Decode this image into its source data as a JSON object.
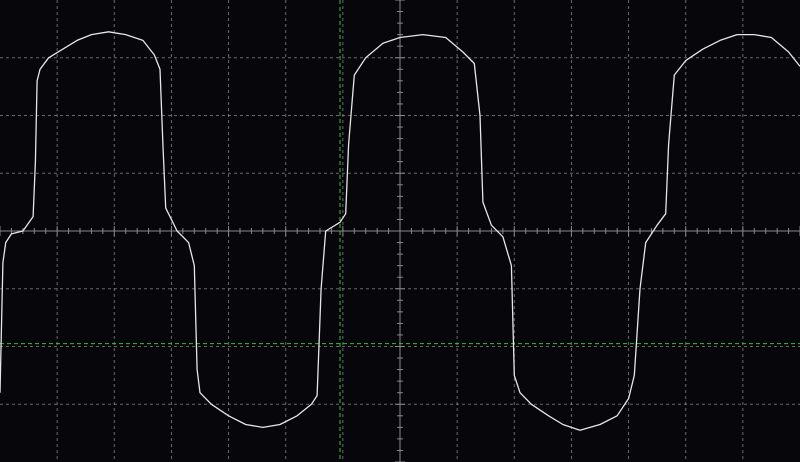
{
  "screen": {
    "background_color": "#07060b",
    "grid_color": "#8a8a8a",
    "trace_color": "#e6e6e6",
    "cursor_color": "#35c23a"
  },
  "graticule": {
    "horizontal_divisions": 14,
    "vertical_divisions": 8,
    "minor_ticks_per_division": 5
  },
  "cursors": {
    "vertical_cursor_division": 5.95,
    "horizontal_cursor_division": -1.95,
    "style": "dashed"
  },
  "chart_data": {
    "type": "line",
    "title": "",
    "xlabel": "",
    "ylabel": "",
    "x_unit": "divisions",
    "y_unit": "divisions",
    "xlim": [
      0,
      14
    ],
    "ylim": [
      -4,
      4
    ],
    "grid": true,
    "series": [
      {
        "values_xy": [
          [
            0.0,
            -2.8
          ],
          [
            0.05,
            -0.55
          ],
          [
            0.1,
            -0.2
          ],
          [
            0.2,
            -0.05
          ],
          [
            0.4,
            0.0
          ],
          [
            0.58,
            0.25
          ],
          [
            0.62,
            1.2
          ],
          [
            0.65,
            2.6
          ],
          [
            0.7,
            2.8
          ],
          [
            0.85,
            3.0
          ],
          [
            1.1,
            3.15
          ],
          [
            1.35,
            3.3
          ],
          [
            1.6,
            3.4
          ],
          [
            1.9,
            3.45
          ],
          [
            2.2,
            3.4
          ],
          [
            2.5,
            3.3
          ],
          [
            2.7,
            3.05
          ],
          [
            2.8,
            2.8
          ],
          [
            2.85,
            1.5
          ],
          [
            2.9,
            0.4
          ],
          [
            3.1,
            0.0
          ],
          [
            3.3,
            -0.2
          ],
          [
            3.4,
            -0.6
          ],
          [
            3.45,
            -2.4
          ],
          [
            3.5,
            -2.8
          ],
          [
            3.7,
            -3.0
          ],
          [
            4.0,
            -3.2
          ],
          [
            4.3,
            -3.35
          ],
          [
            4.6,
            -3.4
          ],
          [
            4.9,
            -3.35
          ],
          [
            5.2,
            -3.2
          ],
          [
            5.45,
            -3.0
          ],
          [
            5.55,
            -2.85
          ],
          [
            5.62,
            -1.0
          ],
          [
            5.7,
            0.0
          ],
          [
            5.95,
            0.15
          ],
          [
            6.05,
            0.3
          ],
          [
            6.1,
            1.5
          ],
          [
            6.2,
            2.7
          ],
          [
            6.4,
            3.0
          ],
          [
            6.7,
            3.25
          ],
          [
            7.0,
            3.35
          ],
          [
            7.4,
            3.4
          ],
          [
            7.8,
            3.35
          ],
          [
            8.1,
            3.1
          ],
          [
            8.3,
            2.9
          ],
          [
            8.4,
            2.0
          ],
          [
            8.45,
            0.5
          ],
          [
            8.6,
            0.1
          ],
          [
            8.8,
            -0.1
          ],
          [
            8.95,
            -0.6
          ],
          [
            9.0,
            -2.5
          ],
          [
            9.1,
            -2.8
          ],
          [
            9.3,
            -3.0
          ],
          [
            9.6,
            -3.2
          ],
          [
            9.85,
            -3.35
          ],
          [
            10.15,
            -3.45
          ],
          [
            10.5,
            -3.35
          ],
          [
            10.8,
            -3.2
          ],
          [
            11.0,
            -2.9
          ],
          [
            11.1,
            -2.5
          ],
          [
            11.2,
            -1.0
          ],
          [
            11.3,
            -0.2
          ],
          [
            11.5,
            0.1
          ],
          [
            11.65,
            0.3
          ],
          [
            11.7,
            1.5
          ],
          [
            11.8,
            2.7
          ],
          [
            12.0,
            2.95
          ],
          [
            12.3,
            3.15
          ],
          [
            12.6,
            3.3
          ],
          [
            12.9,
            3.4
          ],
          [
            13.2,
            3.4
          ],
          [
            13.5,
            3.35
          ],
          [
            13.8,
            3.1
          ],
          [
            14.0,
            2.85
          ]
        ]
      }
    ]
  }
}
